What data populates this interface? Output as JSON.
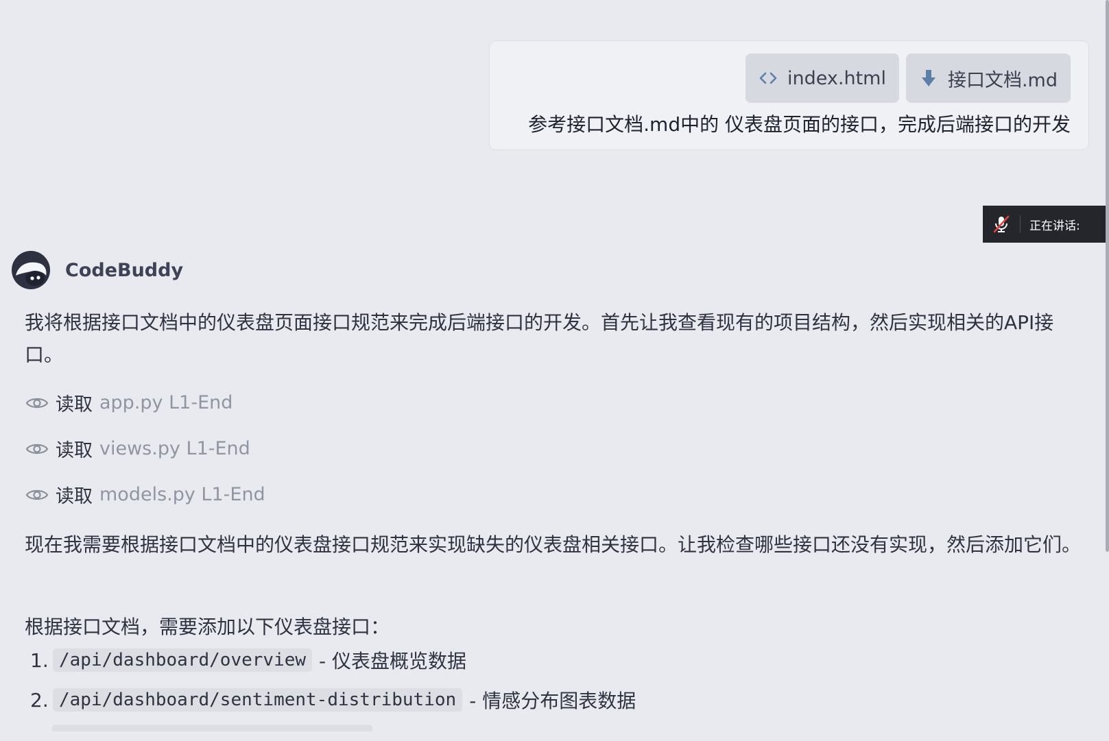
{
  "user_message": {
    "attachments": [
      {
        "name": "index.html",
        "icon": "code-icon"
      },
      {
        "name": "接口文档.md",
        "icon": "download-arrow-icon"
      }
    ],
    "text": "参考接口文档.md中的 仪表盘页面的接口，完成后端接口的开发"
  },
  "speaking_indicator": {
    "label": "正在讲话:",
    "icon": "mic-muted-icon"
  },
  "assistant": {
    "name": "CodeBuddy",
    "intro": "我将根据接口文档中的仪表盘页面接口规范来完成后端接口的开发。首先让我查看现有的项目结构，然后实现相关的API接口。",
    "reads": [
      {
        "verb": "读取",
        "file": "app.py L1-End"
      },
      {
        "verb": "读取",
        "file": "views.py L1-End"
      },
      {
        "verb": "读取",
        "file": "models.py L1-End"
      }
    ],
    "para2": "现在我需要根据接口文档中的仪表盘接口规范来实现缺失的仪表盘相关接口。让我检查哪些接口还没有实现，然后添加它们。",
    "para3": "根据接口文档，需要添加以下仪表盘接口：",
    "endpoints": [
      {
        "num": "1.",
        "path": "/api/dashboard/overview",
        "desc": "- 仪表盘概览数据"
      },
      {
        "num": "2.",
        "path": "/api/dashboard/sentiment-distribution",
        "desc": "- 情感分布图表数据"
      }
    ]
  },
  "colors": {
    "background": "#e9eaef",
    "bubble": "#f0f1f5",
    "attachment_chip": "#d7d9e0",
    "accent_icon": "#5b7fa6",
    "muted_text": "#9095a3"
  }
}
